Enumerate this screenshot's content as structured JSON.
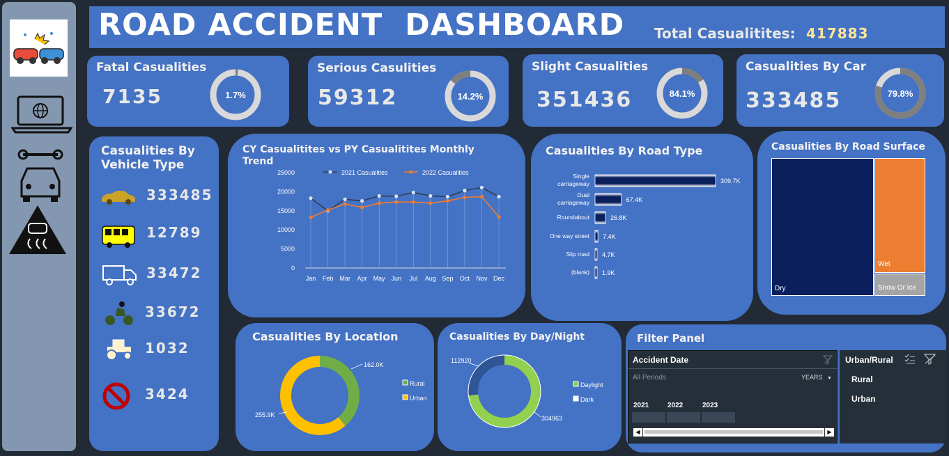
{
  "header": {
    "title": "ROAD ACCIDENT  DASHBOARD",
    "total_label": "Total Casualitites:",
    "total_value": "417883"
  },
  "kpis": [
    {
      "title": "Fatal Casualities",
      "value": "7135",
      "pct_label": "1.7%",
      "pct": 1.7
    },
    {
      "title": "Serious Casulities",
      "value": "59312",
      "pct_label": "14.2%",
      "pct": 14.2
    },
    {
      "title": "Slight Casualities",
      "value": "351436",
      "pct_label": "84.1%",
      "pct": 84.1
    },
    {
      "title": "Casualities By Car",
      "value": "333485",
      "pct_label": "79.8%",
      "pct": 79.8
    }
  ],
  "vehicle": {
    "title": "Casualities By Vehicle Type",
    "items": [
      {
        "icon": "car-icon",
        "value": "333485"
      },
      {
        "icon": "bus-icon",
        "value": "12789"
      },
      {
        "icon": "truck-icon",
        "value": "33472"
      },
      {
        "icon": "motorcycle-icon",
        "value": "33672"
      },
      {
        "icon": "tractor-icon",
        "value": "1032"
      },
      {
        "icon": "prohibited-icon",
        "value": "3424"
      }
    ]
  },
  "colors": {
    "bg": "#222a35",
    "card": "#4472c4",
    "cy": "#2f3f5a",
    "py": "#ed7d31",
    "navy": "#0a1f5c",
    "orange": "#ed7d31",
    "grey": "#a5a5a5",
    "yellow": "#ffc000",
    "green": "#70ad47",
    "lightgreen": "#92d050"
  },
  "chart_data": [
    {
      "type": "line",
      "title": "CY Casualitites vs PY Casualitites Monthly Trend",
      "categories": [
        "Jan",
        "Feb",
        "Mar",
        "Apr",
        "May",
        "Jun",
        "Jul",
        "Aug",
        "Sep",
        "Oct",
        "Nov",
        "Dec"
      ],
      "series": [
        {
          "name": "2021 Casualities",
          "values": [
            18300,
            15000,
            18000,
            17600,
            18900,
            18800,
            19800,
            18900,
            18700,
            20300,
            21100,
            18700
          ]
        },
        {
          "name": "2022 Casualities",
          "values": [
            13300,
            15200,
            16800,
            15900,
            17000,
            17300,
            17300,
            17000,
            17600,
            18500,
            18700,
            13400
          ]
        }
      ],
      "y_ticks": [
        "0",
        "5000",
        "10000",
        "15000",
        "20000",
        "25000"
      ],
      "ylim": [
        0,
        25000
      ],
      "legend": "top"
    },
    {
      "type": "bar",
      "title": "Casualities By Road Type",
      "categories": [
        "Single carriageway",
        "Dual carriageway",
        "Roundabout",
        "One way street",
        "Slip road",
        "(blank)"
      ],
      "values": [
        309.7,
        67.4,
        26.8,
        7.4,
        4.7,
        1.9
      ],
      "labels": [
        "309.7K",
        "67.4K",
        "26.8K",
        "7.4K",
        "4.7K",
        "1.9K"
      ]
    },
    {
      "type": "heatmap",
      "title": "Casualities By Road Surface",
      "categories": [
        "Dry",
        "Wet",
        "Snow Or Ice"
      ]
    },
    {
      "type": "pie",
      "title": "Casualities By Location",
      "categories": [
        "Rural",
        "Urban"
      ],
      "values": [
        162.0,
        255.9
      ],
      "labels": [
        "162.0K",
        "255.9K"
      ]
    },
    {
      "type": "pie",
      "title": "Casualities By Day/Night",
      "categories": [
        "Daylight",
        "Dark"
      ],
      "values": [
        304963,
        112920
      ],
      "labels": [
        "304963",
        "112920"
      ]
    }
  ],
  "filter": {
    "title": "Filter Panel",
    "date_title": "Accident Date",
    "periods": "All Periods",
    "years_label": "YEARS",
    "years": [
      "2021",
      "2022",
      "2023"
    ],
    "ur_title": "Urban/Rural",
    "ur_items": [
      "Rural",
      "Urban"
    ]
  }
}
